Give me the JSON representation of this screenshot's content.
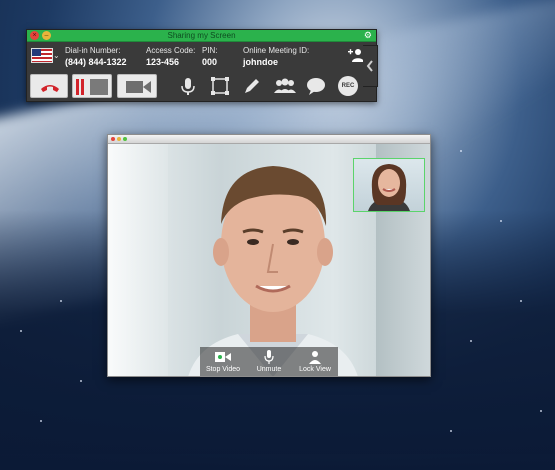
{
  "toolbar": {
    "title": "Sharing my Screen",
    "dial_in_label": "Dial-in Number:",
    "dial_in_value": "(844) 844-1322",
    "access_code_label": "Access Code:",
    "access_code_value": "123-456",
    "pin_label": "PIN:",
    "pin_value": "000",
    "meeting_id_label": "Online Meeting ID:",
    "meeting_id_value": "johndoe",
    "rec_label": "REC"
  },
  "video": {
    "controls": [
      {
        "label": "Stop Video"
      },
      {
        "label": "Unmute"
      },
      {
        "label": "Lock View"
      }
    ]
  },
  "colors": {
    "toolbar_bg": "#3a3a3a",
    "title_bar": "#2bb24c",
    "pip_border": "#5bd46b",
    "hangup_red": "#d2232a"
  }
}
